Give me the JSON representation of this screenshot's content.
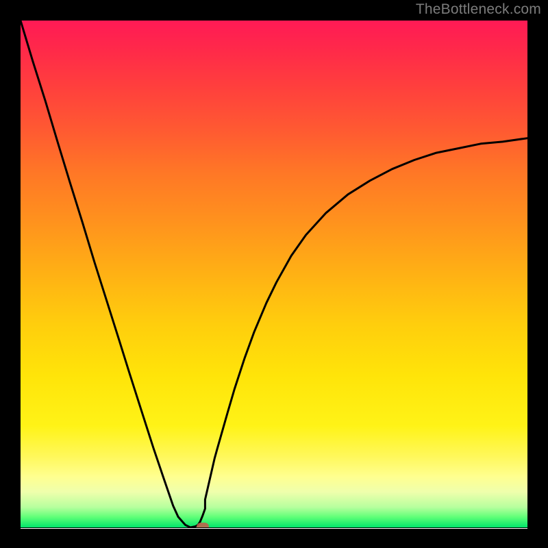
{
  "watermark": "TheBottleneck.com",
  "colors": {
    "frame": "#000000",
    "curve": "#000000",
    "marker": "#c1604b",
    "gradient_top": "#ff1a55",
    "gradient_bottom": "#00e36a"
  },
  "chart_data": {
    "type": "line",
    "title": "",
    "xlabel": "",
    "ylabel": "",
    "xlim": [
      0,
      100
    ],
    "ylim": [
      0,
      100
    ],
    "note": "Values estimated from pixel positions — no numeric axes are visible in the source image.",
    "series": [
      {
        "name": "bottleneck-curve",
        "x": [
          0.0,
          2.4,
          4.9,
          7.3,
          9.7,
          12.2,
          14.6,
          17.0,
          19.5,
          21.4,
          23.8,
          26.2,
          28.2,
          30.1,
          31.1,
          32.5,
          33.5,
          34.5,
          35.0,
          35.4,
          35.9,
          36.4,
          36.4,
          38.3,
          38.8,
          40.8,
          42.2,
          44.2,
          46.1,
          48.5,
          50.5,
          53.4,
          56.3,
          60.2,
          64.6,
          68.9,
          73.3,
          77.7,
          82.0,
          86.4,
          90.8,
          95.1,
          100.0
        ],
        "y": [
          100.0,
          92.0,
          84.1,
          76.1,
          68.2,
          60.2,
          52.3,
          44.7,
          36.8,
          30.7,
          23.2,
          15.7,
          9.8,
          4.3,
          2.1,
          0.5,
          0.0,
          0.2,
          0.5,
          1.1,
          2.3,
          3.7,
          5.5,
          13.7,
          15.5,
          22.5,
          27.3,
          33.4,
          38.6,
          44.3,
          48.4,
          53.6,
          57.7,
          62.0,
          65.7,
          68.4,
          70.7,
          72.5,
          73.9,
          74.8,
          75.7,
          76.1,
          76.8
        ],
        "color": "#000000"
      }
    ],
    "marker": {
      "x": 35.9,
      "y": 0.2
    },
    "annotations": []
  }
}
